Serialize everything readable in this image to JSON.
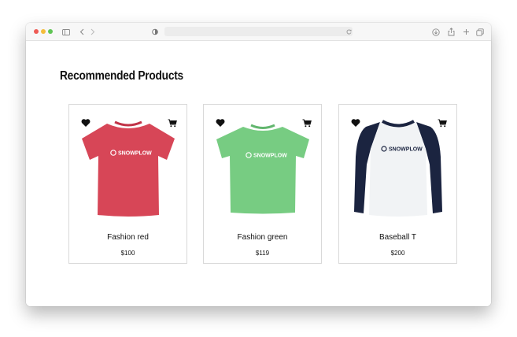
{
  "section": {
    "title": "Recommended Products"
  },
  "icons": {
    "wishlist": "heart-icon",
    "cart": "shopping-cart-icon"
  },
  "products": [
    {
      "name": "Fashion red",
      "price": "$100",
      "color": "#d74657",
      "logo": "SNOWPLOW"
    },
    {
      "name": "Fashion green",
      "price": "$119",
      "color": "#77cc82",
      "logo": "SNOWPLOW"
    },
    {
      "name": "Baseball T",
      "price": "$200",
      "color": "#1b2440",
      "logo": "SNOWPLOW"
    }
  ],
  "colors": {
    "close": "#ee5b55",
    "minimize": "#f4bd3a",
    "maximize": "#5fc454",
    "card_border": "#d9d9d9",
    "baseball_body": "#f1f3f5"
  }
}
